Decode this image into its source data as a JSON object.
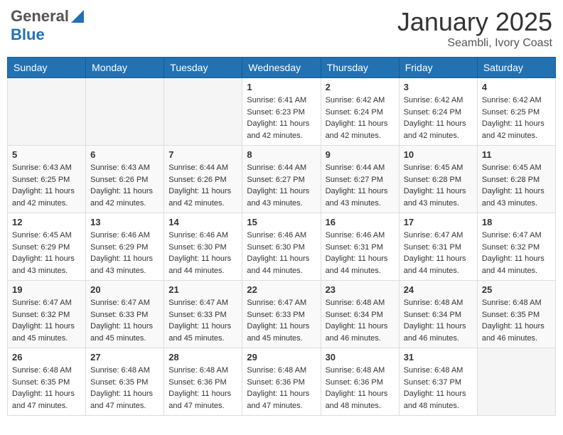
{
  "header": {
    "logo_general": "General",
    "logo_blue": "Blue",
    "month_title": "January 2025",
    "location": "Seambli, Ivory Coast"
  },
  "days_of_week": [
    "Sunday",
    "Monday",
    "Tuesday",
    "Wednesday",
    "Thursday",
    "Friday",
    "Saturday"
  ],
  "weeks": [
    [
      {
        "day": "",
        "info": ""
      },
      {
        "day": "",
        "info": ""
      },
      {
        "day": "",
        "info": ""
      },
      {
        "day": "1",
        "info": "Sunrise: 6:41 AM\nSunset: 6:23 PM\nDaylight: 11 hours\nand 42 minutes."
      },
      {
        "day": "2",
        "info": "Sunrise: 6:42 AM\nSunset: 6:24 PM\nDaylight: 11 hours\nand 42 minutes."
      },
      {
        "day": "3",
        "info": "Sunrise: 6:42 AM\nSunset: 6:24 PM\nDaylight: 11 hours\nand 42 minutes."
      },
      {
        "day": "4",
        "info": "Sunrise: 6:42 AM\nSunset: 6:25 PM\nDaylight: 11 hours\nand 42 minutes."
      }
    ],
    [
      {
        "day": "5",
        "info": "Sunrise: 6:43 AM\nSunset: 6:25 PM\nDaylight: 11 hours\nand 42 minutes."
      },
      {
        "day": "6",
        "info": "Sunrise: 6:43 AM\nSunset: 6:26 PM\nDaylight: 11 hours\nand 42 minutes."
      },
      {
        "day": "7",
        "info": "Sunrise: 6:44 AM\nSunset: 6:26 PM\nDaylight: 11 hours\nand 42 minutes."
      },
      {
        "day": "8",
        "info": "Sunrise: 6:44 AM\nSunset: 6:27 PM\nDaylight: 11 hours\nand 43 minutes."
      },
      {
        "day": "9",
        "info": "Sunrise: 6:44 AM\nSunset: 6:27 PM\nDaylight: 11 hours\nand 43 minutes."
      },
      {
        "day": "10",
        "info": "Sunrise: 6:45 AM\nSunset: 6:28 PM\nDaylight: 11 hours\nand 43 minutes."
      },
      {
        "day": "11",
        "info": "Sunrise: 6:45 AM\nSunset: 6:28 PM\nDaylight: 11 hours\nand 43 minutes."
      }
    ],
    [
      {
        "day": "12",
        "info": "Sunrise: 6:45 AM\nSunset: 6:29 PM\nDaylight: 11 hours\nand 43 minutes."
      },
      {
        "day": "13",
        "info": "Sunrise: 6:46 AM\nSunset: 6:29 PM\nDaylight: 11 hours\nand 43 minutes."
      },
      {
        "day": "14",
        "info": "Sunrise: 6:46 AM\nSunset: 6:30 PM\nDaylight: 11 hours\nand 44 minutes."
      },
      {
        "day": "15",
        "info": "Sunrise: 6:46 AM\nSunset: 6:30 PM\nDaylight: 11 hours\nand 44 minutes."
      },
      {
        "day": "16",
        "info": "Sunrise: 6:46 AM\nSunset: 6:31 PM\nDaylight: 11 hours\nand 44 minutes."
      },
      {
        "day": "17",
        "info": "Sunrise: 6:47 AM\nSunset: 6:31 PM\nDaylight: 11 hours\nand 44 minutes."
      },
      {
        "day": "18",
        "info": "Sunrise: 6:47 AM\nSunset: 6:32 PM\nDaylight: 11 hours\nand 44 minutes."
      }
    ],
    [
      {
        "day": "19",
        "info": "Sunrise: 6:47 AM\nSunset: 6:32 PM\nDaylight: 11 hours\nand 45 minutes."
      },
      {
        "day": "20",
        "info": "Sunrise: 6:47 AM\nSunset: 6:33 PM\nDaylight: 11 hours\nand 45 minutes."
      },
      {
        "day": "21",
        "info": "Sunrise: 6:47 AM\nSunset: 6:33 PM\nDaylight: 11 hours\nand 45 minutes."
      },
      {
        "day": "22",
        "info": "Sunrise: 6:47 AM\nSunset: 6:33 PM\nDaylight: 11 hours\nand 45 minutes."
      },
      {
        "day": "23",
        "info": "Sunrise: 6:48 AM\nSunset: 6:34 PM\nDaylight: 11 hours\nand 46 minutes."
      },
      {
        "day": "24",
        "info": "Sunrise: 6:48 AM\nSunset: 6:34 PM\nDaylight: 11 hours\nand 46 minutes."
      },
      {
        "day": "25",
        "info": "Sunrise: 6:48 AM\nSunset: 6:35 PM\nDaylight: 11 hours\nand 46 minutes."
      }
    ],
    [
      {
        "day": "26",
        "info": "Sunrise: 6:48 AM\nSunset: 6:35 PM\nDaylight: 11 hours\nand 47 minutes."
      },
      {
        "day": "27",
        "info": "Sunrise: 6:48 AM\nSunset: 6:35 PM\nDaylight: 11 hours\nand 47 minutes."
      },
      {
        "day": "28",
        "info": "Sunrise: 6:48 AM\nSunset: 6:36 PM\nDaylight: 11 hours\nand 47 minutes."
      },
      {
        "day": "29",
        "info": "Sunrise: 6:48 AM\nSunset: 6:36 PM\nDaylight: 11 hours\nand 47 minutes."
      },
      {
        "day": "30",
        "info": "Sunrise: 6:48 AM\nSunset: 6:36 PM\nDaylight: 11 hours\nand 48 minutes."
      },
      {
        "day": "31",
        "info": "Sunrise: 6:48 AM\nSunset: 6:37 PM\nDaylight: 11 hours\nand 48 minutes."
      },
      {
        "day": "",
        "info": ""
      }
    ]
  ]
}
